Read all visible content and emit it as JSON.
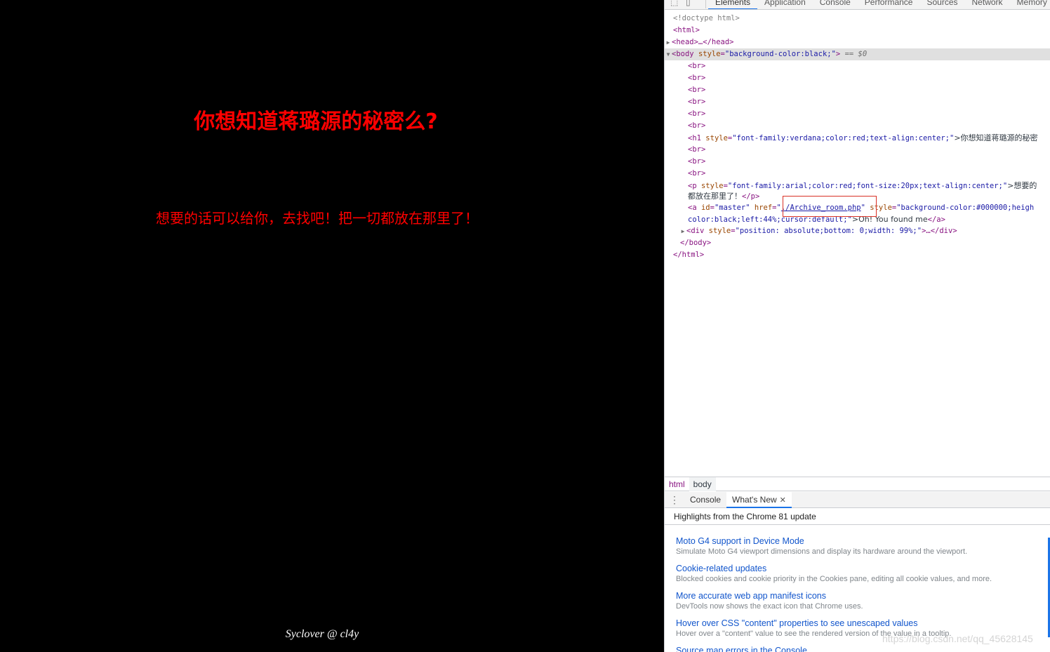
{
  "page": {
    "title": "你想知道蒋璐源的秘密么?",
    "subtitle": "想要的话可以给你，去找吧！把一切都放在那里了！",
    "signature": "Syclover @ cl4y"
  },
  "devtools": {
    "tabs": [
      "Elements",
      "Application",
      "Console",
      "Performance",
      "Sources",
      "Network",
      "Memory"
    ],
    "active_tab": "Elements",
    "dom": {
      "doctype": "<!doctype html>",
      "html_open": "<html>",
      "head": "<head>…</head>",
      "body_open_tag": "<body",
      "body_attr_name": "style",
      "body_attr_value": "\"background-color:black;\"",
      "body_close_bracket": ">",
      "body_eq": "== $0",
      "br": "<br>",
      "h1_open": "<h1",
      "h1_attr_name": "style",
      "h1_attr_value": "\"font-family:verdana;color:red;text-align:center;\"",
      "h1_text": ">你想知道蒋璐源的秘密",
      "p_open": "<p",
      "p_attr_name": "style",
      "p_attr_value": "\"font-family:arial;color:red;font-size:20px;text-align:center;\"",
      "p_text": ">想要的",
      "p_line2_text": "都放在那里了！",
      "p_close": "</p>",
      "a_open": "<a",
      "a_id_name": "id",
      "a_id_value": "\"master\"",
      "a_href_name": "href",
      "a_href_value": "./Archive_room.php",
      "a_style_name": "style",
      "a_style_value": "\"background-color:#000000;heigh",
      "a_line2_style": "color:black;left:44%;cursor:default;\"",
      "a_text": ">Oh! You found me",
      "a_close": "</a>",
      "div_open": "<div",
      "div_attr_name": "style",
      "div_attr_value": "\"position: absolute;bottom: 0;width: 99%;\"",
      "div_rest": ">…</div>",
      "body_close": "</body>",
      "html_close": "</html>"
    },
    "breadcrumbs": [
      "html",
      "body"
    ],
    "drawer": {
      "tabs": [
        "Console",
        "What's New"
      ],
      "active_tab": "What's New",
      "header": "Highlights from the Chrome 81 update",
      "items": [
        {
          "title": "Moto G4 support in Device Mode",
          "desc": "Simulate Moto G4 viewport dimensions and display its hardware around the viewport."
        },
        {
          "title": "Cookie-related updates",
          "desc": "Blocked cookies and cookie priority in the Cookies pane, editing all cookie values, and more."
        },
        {
          "title": "More accurate web app manifest icons",
          "desc": "DevTools now shows the exact icon that Chrome uses."
        },
        {
          "title": "Hover over CSS \"content\" properties to see unescaped values",
          "desc": "Hover over a \"content\" value to see the rendered version of the value in a tooltip."
        },
        {
          "title": "Source map errors in the Console",
          "desc": ""
        }
      ]
    }
  },
  "watermark": "https://blog.csdn.net/qq_45628145",
  "colors": {
    "page_text": "#ff0000",
    "page_bg": "#000000",
    "accent": "#1a73e8",
    "link": "#1155cc"
  }
}
